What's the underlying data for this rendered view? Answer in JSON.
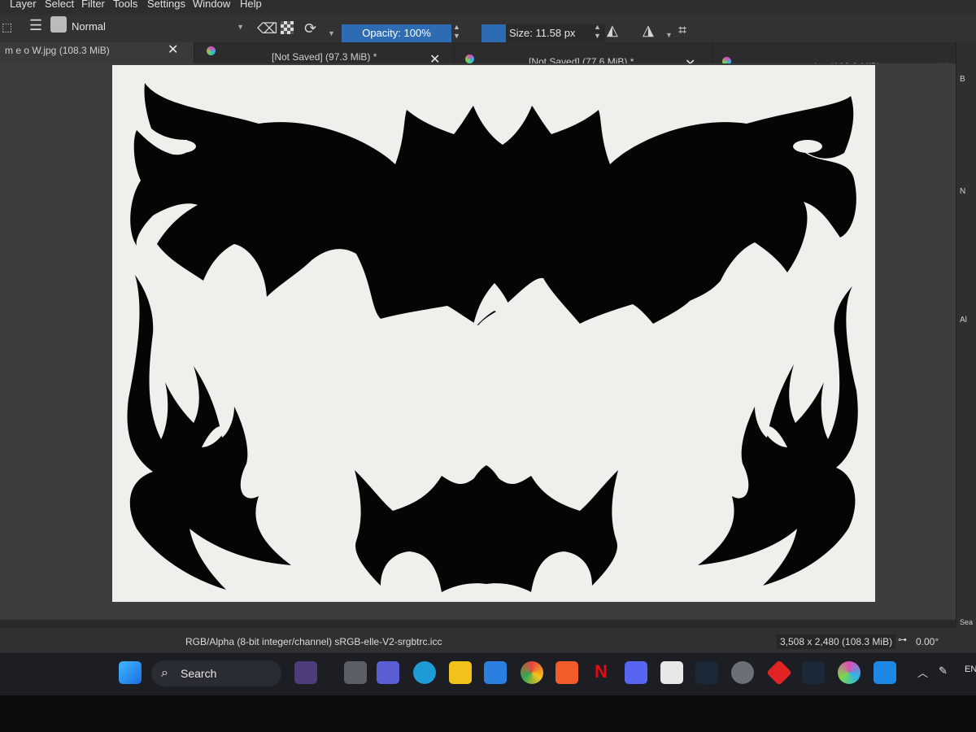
{
  "menu": [
    "Layer",
    "Select",
    "Filter",
    "Tools",
    "Settings",
    "Window",
    "Help"
  ],
  "toolbar": {
    "blend_mode": "Normal",
    "opacity_label": "Opacity: 100%",
    "size_label": "Size: 11.58 px"
  },
  "tabs": [
    {
      "title": "m e o W.jpg (108.3 MiB)",
      "active": true
    },
    {
      "title": "[Not Saved]  (97.3 MiB) *",
      "active": false
    },
    {
      "title": "[Not Saved]  (77.6 MiB) *",
      "active": false
    },
    {
      "title": "crs++.jpg (102.8 MiB)",
      "active": false
    }
  ],
  "status": {
    "color_space": "RGB/Alpha (8-bit integer/channel)  sRGB-elle-V2-srgbtrc.icc",
    "dimensions": "3,508 x 2,480 (108.3 MiB)",
    "rotation": "0.00°"
  },
  "docker": {
    "labels": [
      "B",
      "N",
      "Al",
      "Sea"
    ]
  },
  "taskbar": {
    "search_label": "Search",
    "tray_lang": "EN",
    "apps": [
      "start",
      "search",
      "task-view",
      "meet",
      "edge",
      "file-explorer",
      "mail",
      "chrome",
      "brave",
      "netflix",
      "discord",
      "notepad",
      "steam",
      "settings",
      "red-app",
      "steam-2",
      "krita",
      "paint"
    ]
  },
  "colors": {
    "accent": "#2d6cb3",
    "ink": "#050505",
    "paper": "#f1efec"
  }
}
